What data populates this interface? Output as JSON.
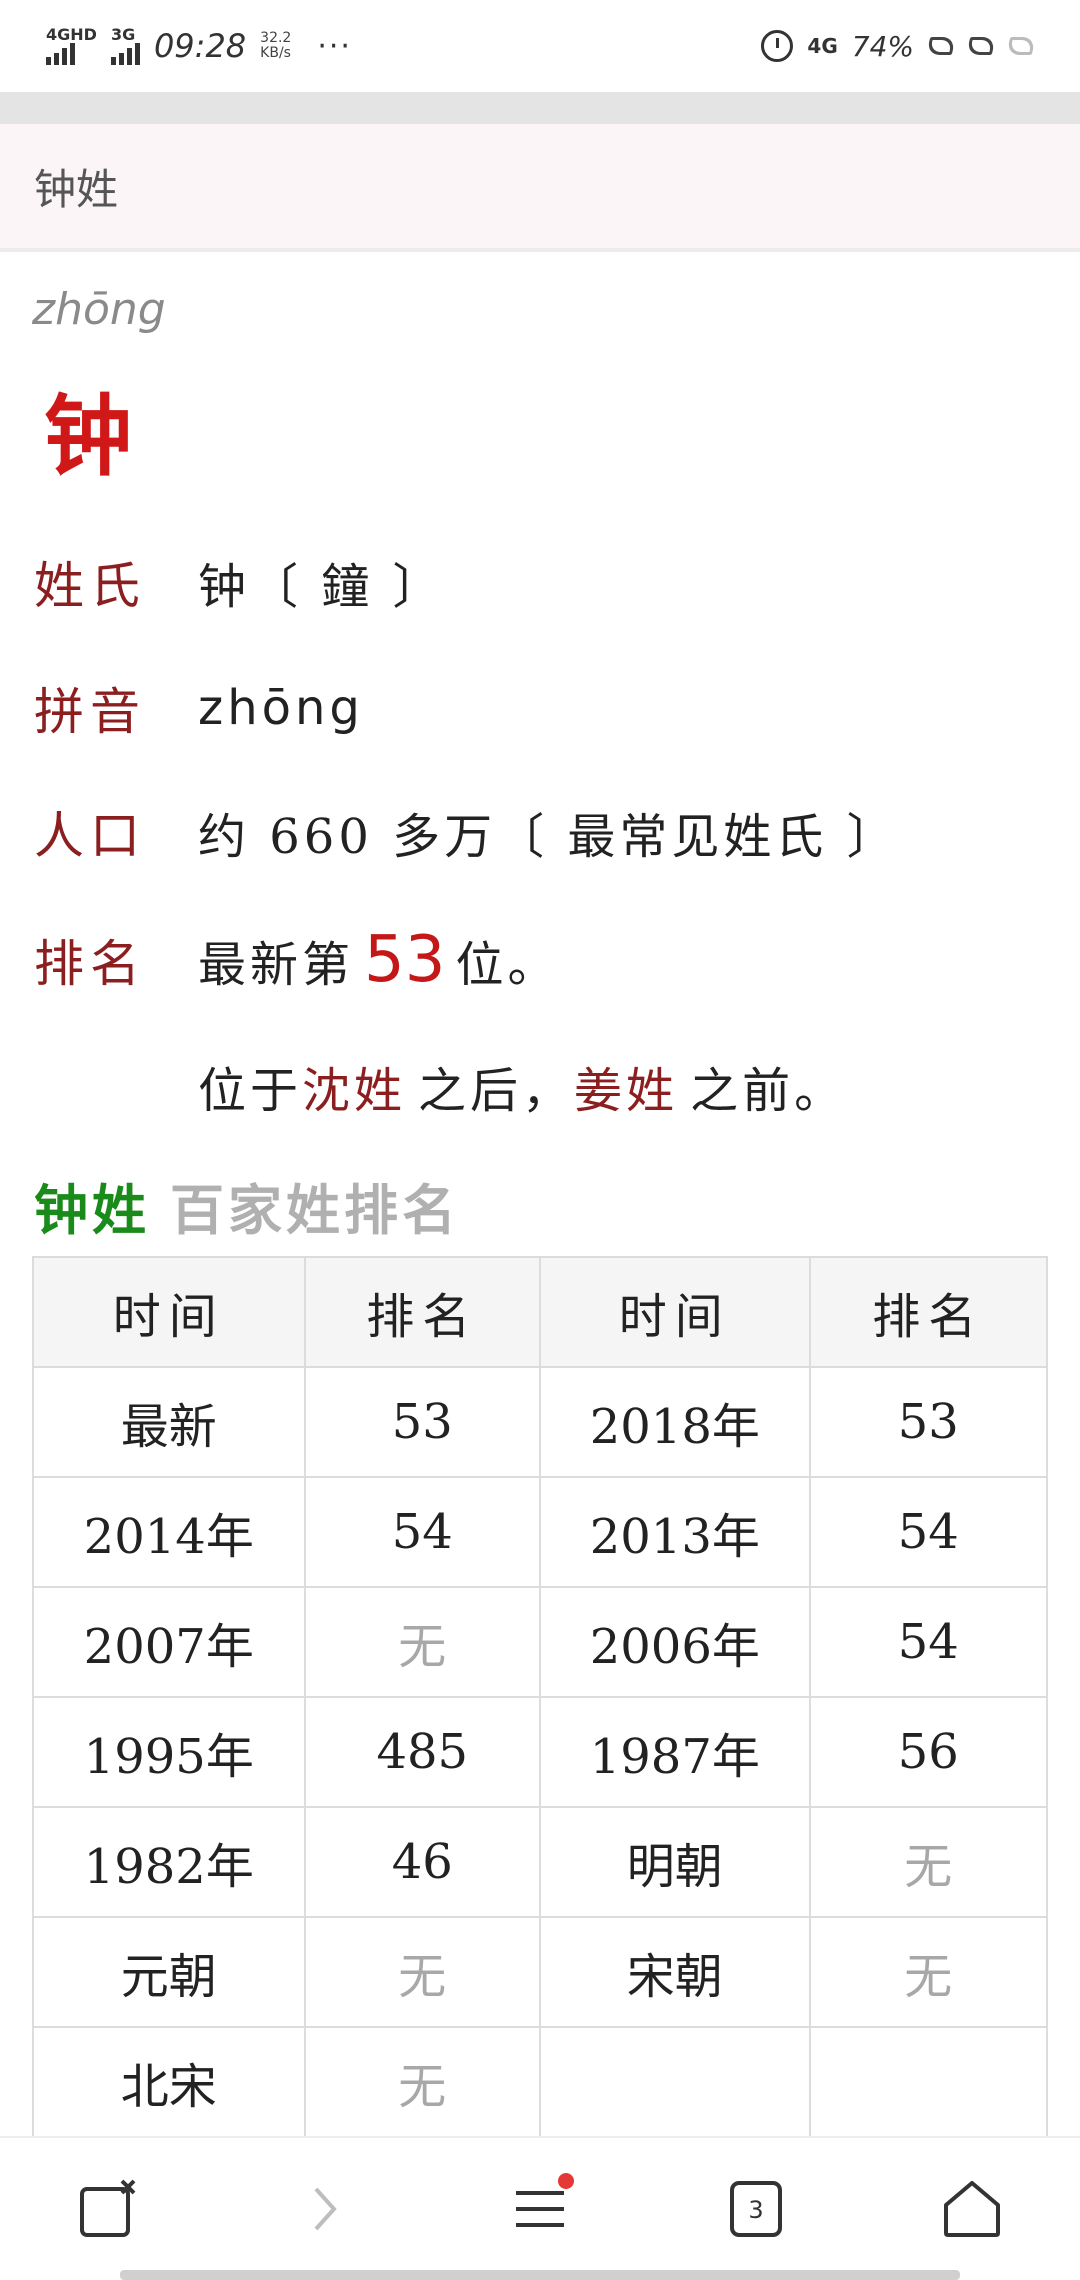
{
  "status_bar": {
    "net1": "4GHD",
    "net2": "3G",
    "time": "09:28",
    "speed_value": "32.2",
    "speed_unit": "KB/s",
    "more": "···",
    "sim_label": "4G",
    "battery": "74%"
  },
  "header": {
    "title": "钟姓"
  },
  "surname": {
    "pinyin": "zhōng",
    "character": "钟"
  },
  "info": {
    "surname_label": "姓氏",
    "surname_value": "钟〔 鐘 〕",
    "pinyin_label": "拼音",
    "pinyin_value": "zhōng",
    "population_label": "人口",
    "population_value": "约 660 多万〔 最常见姓氏 〕",
    "rank_label": "排名",
    "rank_prefix": "最新第",
    "rank_number": "53",
    "rank_suffix": "位。",
    "position_prefix": "位于",
    "before_surname": "沈姓",
    "position_middle": "之后，",
    "after_surname": "姜姓",
    "position_suffix": "之前。"
  },
  "section": {
    "title_surname": "钟姓",
    "title_rest": "百家姓排名"
  },
  "table": {
    "headers": [
      "时间",
      "排名",
      "时间",
      "排名"
    ],
    "rows": [
      [
        "最新",
        "53",
        "2018年",
        "53"
      ],
      [
        "2014年",
        "54",
        "2013年",
        "54"
      ],
      [
        "2007年",
        "无",
        "2006年",
        "54"
      ],
      [
        "1995年",
        "485",
        "1987年",
        "56"
      ],
      [
        "1982年",
        "46",
        "明朝",
        "无"
      ],
      [
        "元朝",
        "无",
        "宋朝",
        "无"
      ],
      [
        "北宋",
        "无",
        "",
        ""
      ]
    ]
  },
  "bottom_nav": {
    "tabs_count": "3"
  },
  "colors": {
    "accent_red": "#d11818",
    "label_red": "#8b1f1f",
    "green": "#1a8a1a"
  }
}
